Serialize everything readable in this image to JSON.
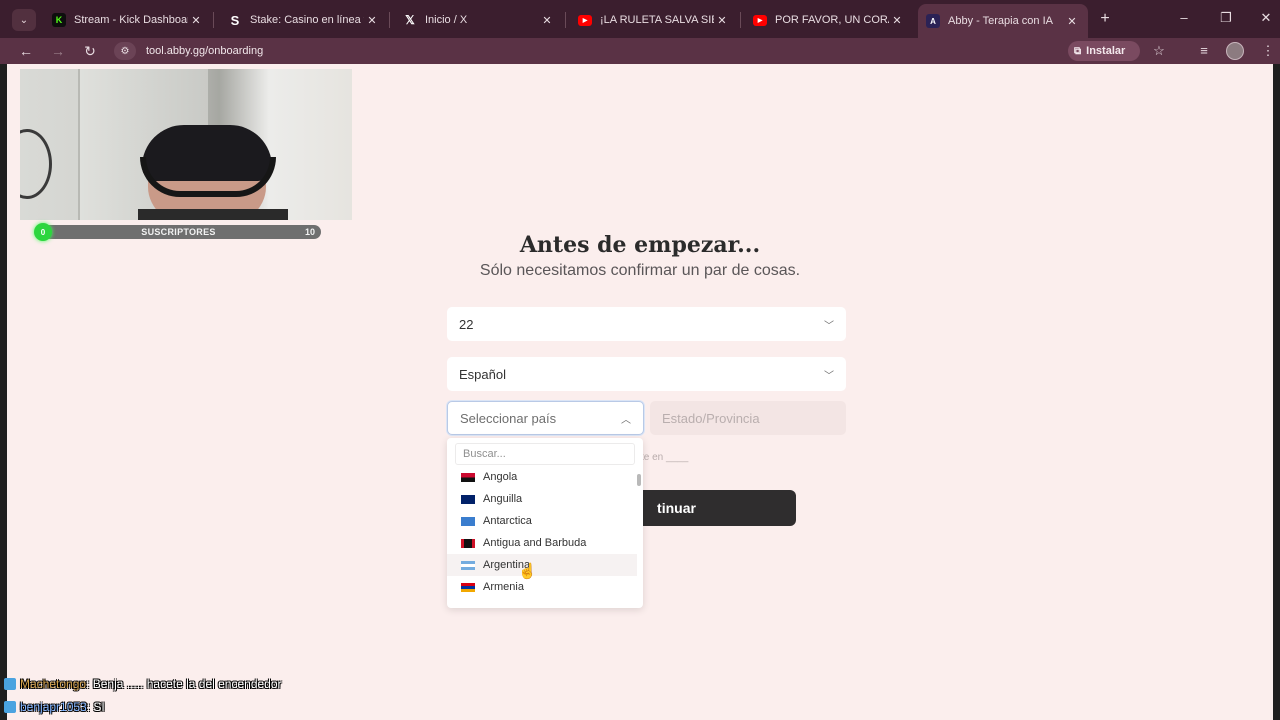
{
  "browser": {
    "tabs": [
      {
        "title": "Stream - Kick Dashboard",
        "favicon": "kick-icon",
        "active": false
      },
      {
        "title": "Stake: Casino en línea y",
        "favicon": "stake-icon",
        "active": false
      },
      {
        "title": "Inicio / X",
        "favicon": "x-icon",
        "active": false
      },
      {
        "title": "¡LA RULETA SALVA SIEM",
        "favicon": "youtube-icon",
        "active": false
      },
      {
        "title": "POR FAVOR, UN CORAZ",
        "favicon": "youtube-icon",
        "active": false
      },
      {
        "title": "Abby - Terapia con IA",
        "favicon": "abby-icon",
        "active": true
      }
    ],
    "url": "tool.abby.gg/onboarding",
    "install_label": "Instalar"
  },
  "overlay": {
    "subs_goal_current": "0",
    "subs_label": "SUSCRIPTORES",
    "subs_goal_target": "10",
    "chat": [
      {
        "user": "Machetongo",
        "message": ": Benja ..... hacete la del encendedor",
        "user_color": "#d4a24c"
      },
      {
        "user": "benjapr1053",
        "message": ": SI",
        "user_color": "#7fb3ff"
      }
    ]
  },
  "onboarding": {
    "title": "Antes de empezar...",
    "subtitle": "Sólo necesitamos confirmar un par de cosas.",
    "age_value": "22",
    "language_value": "Español",
    "country_placeholder": "Seleccionar país",
    "state_placeholder": "Estado/Provincia",
    "hint_fragment": "te en ____",
    "continue_label": "tinuar",
    "search_placeholder": "Buscar...",
    "countries": [
      {
        "name": "Angola",
        "flag": "angola-flag"
      },
      {
        "name": "Anguilla",
        "flag": "anguilla-flag"
      },
      {
        "name": "Antarctica",
        "flag": "antarctica-flag"
      },
      {
        "name": "Antigua and Barbuda",
        "flag": "antigua-flag"
      },
      {
        "name": "Argentina",
        "flag": "argentina-flag",
        "hovered": true
      },
      {
        "name": "Armenia",
        "flag": "armenia-flag"
      }
    ]
  },
  "colors": {
    "page_bg": "#fbeeed",
    "browser_frame": "#3b1e2e",
    "button_dark": "#2f2d2e",
    "subs_green": "#2cd63e"
  }
}
